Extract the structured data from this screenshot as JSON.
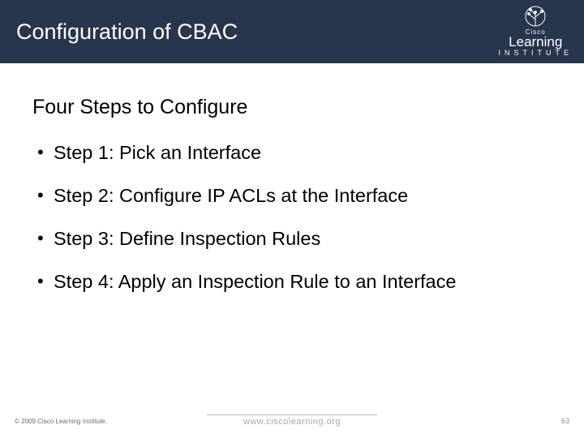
{
  "header": {
    "title": "Configuration of CBAC",
    "logo": {
      "brand_small": "Cisco",
      "brand_main": "Learning",
      "brand_sub": "INSTITUTE"
    }
  },
  "content": {
    "subtitle": "Four Steps to Configure",
    "steps": [
      "Step 1: Pick an Interface",
      "Step 2: Configure IP ACLs at the Interface",
      "Step 3: Define Inspection Rules",
      "Step 4: Apply an Inspection Rule to an Interface"
    ]
  },
  "footer": {
    "copyright": "© 2009 Cisco Learning Institute.",
    "url": "www.ciscolearning.org",
    "page_number": "63"
  }
}
